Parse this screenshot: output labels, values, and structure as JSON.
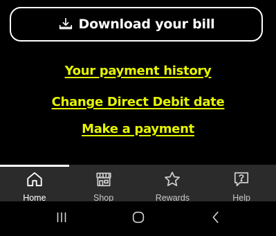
{
  "download": {
    "label": "Download your bill",
    "icon": "download-tray-icon"
  },
  "links": [
    {
      "label": "Your payment history"
    },
    {
      "label": "Change Direct Debit date"
    },
    {
      "label": "Make a payment"
    }
  ],
  "colors": {
    "link": "#e6f500",
    "background": "#000000",
    "tabbar": "#2b2b2b",
    "active_indicator": "#ffffff"
  },
  "tabs": [
    {
      "label": "Home",
      "icon": "home-icon",
      "active": true
    },
    {
      "label": "Shop",
      "icon": "shop-icon",
      "active": false
    },
    {
      "label": "Rewards",
      "icon": "star-icon",
      "active": false
    },
    {
      "label": "Help",
      "icon": "help-chat-icon",
      "active": false
    }
  ],
  "system_nav": {
    "buttons": [
      {
        "icon": "recent-apps-icon"
      },
      {
        "icon": "home-circle-icon"
      },
      {
        "icon": "back-chevron-icon"
      }
    ]
  }
}
